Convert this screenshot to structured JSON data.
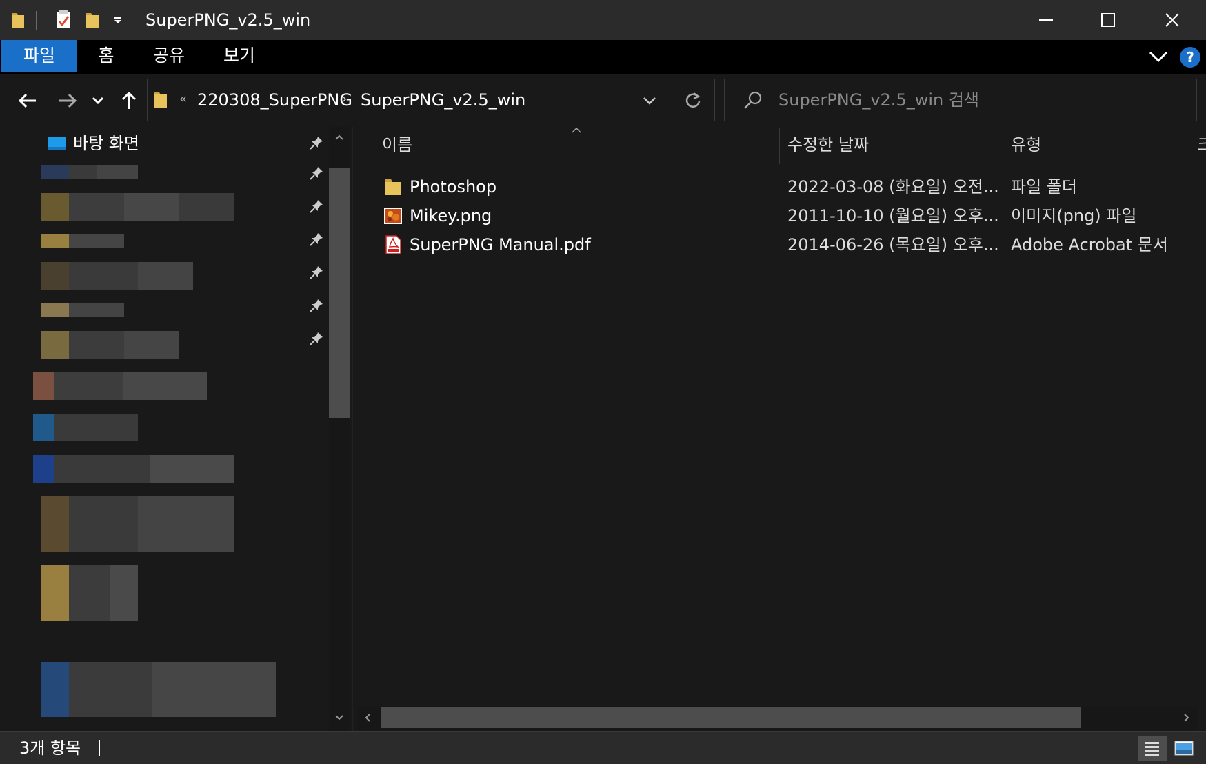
{
  "window": {
    "title": "SuperPNG_v2.5_win",
    "minimize_label": "—",
    "maximize_label": "☐",
    "close_label": "✕"
  },
  "ribbon": {
    "tabs": [
      {
        "label": "파일"
      },
      {
        "label": "홈"
      },
      {
        "label": "공유"
      },
      {
        "label": "보기"
      }
    ],
    "help_label": "?"
  },
  "nav": {
    "back_icon": "arrow-left-icon",
    "forward_icon": "arrow-right-icon",
    "recent_icon": "chevron-down-icon",
    "up_icon": "arrow-up-icon"
  },
  "address": {
    "overflow": "«",
    "crumbs": [
      "220308_SuperPNG",
      "SuperPNG_v2.5_win"
    ],
    "separator": "›"
  },
  "search": {
    "placeholder": "SuperPNG_v2.5_win 검색"
  },
  "navpane": {
    "desktop_label": "바탕 화면"
  },
  "columns": {
    "name": "이름",
    "date": "수정한 날짜",
    "type": "유형",
    "size": "크"
  },
  "files": [
    {
      "name": "Photoshop",
      "date": "2022-03-08 (화요일) 오전...",
      "type": "파일 폴더",
      "icon": "folder-icon"
    },
    {
      "name": "Mikey.png",
      "date": "2011-10-10 (월요일) 오후...",
      "type": "이미지(png) 파일",
      "icon": "png-image-icon"
    },
    {
      "name": "SuperPNG Manual.pdf",
      "date": "2014-06-26 (목요일) 오후...",
      "type": "Adobe Acrobat 문서",
      "icon": "pdf-icon"
    }
  ],
  "status": {
    "item_count": "3개 항목"
  },
  "colors": {
    "accent": "#1a6fc9",
    "background": "#191919",
    "titlebar": "#2b2b2b",
    "folder": "#e8c25a"
  }
}
